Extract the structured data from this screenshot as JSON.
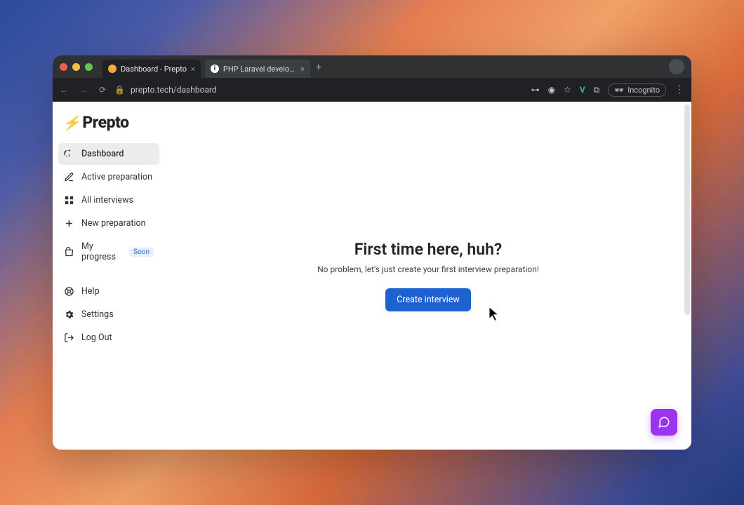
{
  "browser": {
    "tabs": [
      {
        "title": "Dashboard - Prepto",
        "active": true
      },
      {
        "title": "PHP Laravel developer - Re…",
        "active": false
      }
    ],
    "url": "prepto.tech/dashboard",
    "incognito_label": "Incognito"
  },
  "brand": {
    "name": "Prepto"
  },
  "sidebar": {
    "items": [
      {
        "label": "Dashboard",
        "icon": "gauge-icon",
        "active": true
      },
      {
        "label": "Active preparation",
        "icon": "edit-icon"
      },
      {
        "label": "All interviews",
        "icon": "grid-icon"
      },
      {
        "label": "New preparation",
        "icon": "plus-icon"
      },
      {
        "label": "My progress",
        "icon": "bag-icon",
        "badge": "Soon"
      }
    ],
    "footer": [
      {
        "label": "Help",
        "icon": "lifebuoy-icon"
      },
      {
        "label": "Settings",
        "icon": "gear-icon"
      },
      {
        "label": "Log Out",
        "icon": "logout-icon"
      }
    ]
  },
  "main": {
    "headline": "First time here, huh?",
    "subtext": "No problem, let's just create your first interview preparation!",
    "cta": "Create interview"
  },
  "colors": {
    "accent": "#1e62d0",
    "brand_bolt": "#f5a623",
    "fab": "#9b34f0"
  }
}
